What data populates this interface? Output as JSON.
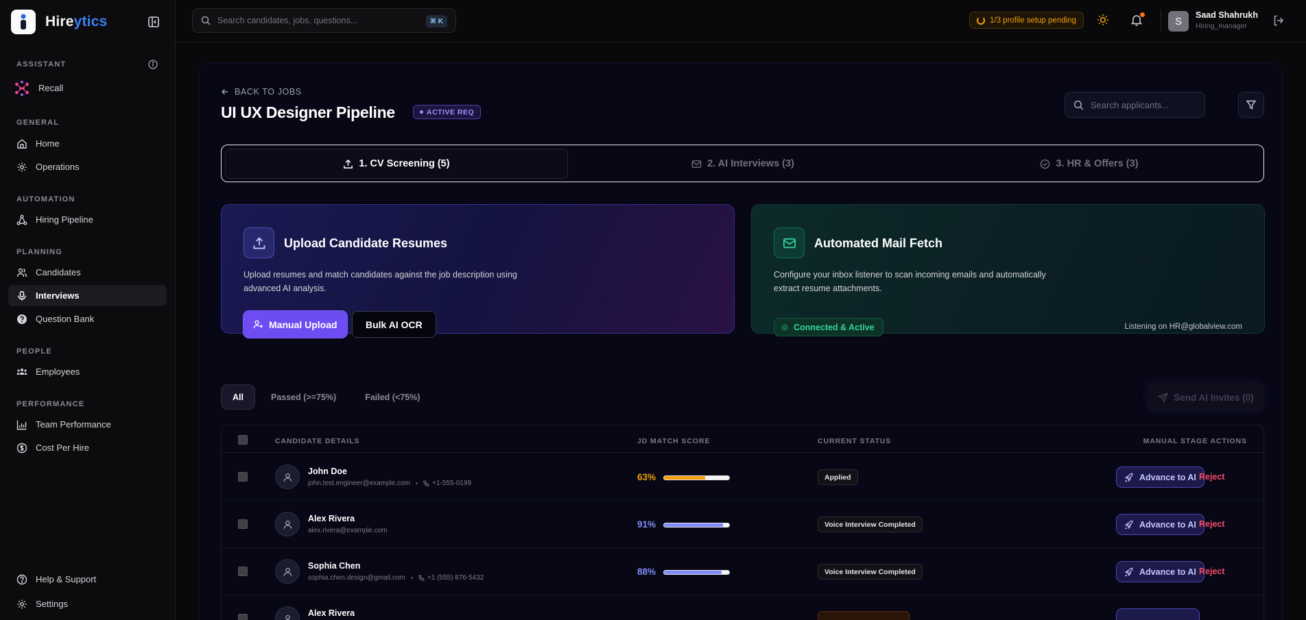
{
  "brand": {
    "name_main": "Hire",
    "name_accent": "ytics"
  },
  "sidebar": {
    "sections": [
      {
        "label": "ASSISTANT"
      },
      {
        "label": "GENERAL"
      },
      {
        "label": "AUTOMATION"
      },
      {
        "label": "PLANNING"
      },
      {
        "label": "PEOPLE"
      },
      {
        "label": "PERFORMANCE"
      }
    ],
    "items": [
      {
        "label": "Recall",
        "icon": "recall-icon"
      },
      {
        "label": "Home",
        "icon": "home-icon"
      },
      {
        "label": "Operations",
        "icon": "gear-icon"
      },
      {
        "label": "Hiring Pipeline",
        "icon": "pipeline-icon"
      },
      {
        "label": "Candidates",
        "icon": "users-icon"
      },
      {
        "label": "Interviews",
        "icon": "mic-icon",
        "active": true
      },
      {
        "label": "Question Bank",
        "icon": "question-icon"
      },
      {
        "label": "Employees",
        "icon": "team-icon"
      },
      {
        "label": "Team Performance",
        "icon": "chart-icon"
      },
      {
        "label": "Cost Per Hire",
        "icon": "dollar-icon"
      }
    ],
    "footer": [
      {
        "label": "Help & Support",
        "icon": "help-icon"
      },
      {
        "label": "Settings",
        "icon": "settings-icon"
      }
    ]
  },
  "topbar": {
    "search_placeholder": "Search candidates, jobs, questions...",
    "shortcut": "⌘ K",
    "pending": "1/3 profile setup pending",
    "user": {
      "initial": "S",
      "name": "Saad Shahrukh",
      "role": "Hiring_manager"
    }
  },
  "page": {
    "back_label": "BACK TO JOBS",
    "title": "UI UX Designer Pipeline",
    "badge": "ACTIVE REQ",
    "search_placeholder": "Search applicants..."
  },
  "tabs": [
    {
      "label": "1. CV Screening (5)",
      "icon": "upload-icon",
      "active": true
    },
    {
      "label": "2. AI Interviews (3)",
      "icon": "mail-icon"
    },
    {
      "label": "3. HR & Offers (3)",
      "icon": "check-circle-icon"
    }
  ],
  "upload_card": {
    "title": "Upload Candidate Resumes",
    "desc": "Upload resumes and match candidates against the job description using advanced AI analysis.",
    "primary": "Manual Upload",
    "secondary": "Bulk AI OCR"
  },
  "mail_card": {
    "title": "Automated Mail Fetch",
    "desc": "Configure your inbox listener to scan incoming emails and automatically extract resume attachments.",
    "status": "Connected & Active",
    "listening": "Listening on HR@globalview.com"
  },
  "filters": [
    {
      "label": "All",
      "active": true
    },
    {
      "label": "Passed (>=75%)"
    },
    {
      "label": "Failed (<75%)"
    }
  ],
  "send_invites": "Send AI Invites (0)",
  "table": {
    "headers": [
      "CANDIDATE DETAILS",
      "JD MATCH SCORE",
      "CURRENT STATUS",
      "MANUAL STAGE ACTIONS"
    ],
    "advance_label": "Advance to AI",
    "reject_label": "Reject",
    "rows": [
      {
        "name": "John Doe",
        "email": "john.test.engineer@example.com",
        "phone": "+1-555-0199",
        "score": "63%",
        "score_value": 63,
        "score_color": "#f59e0b",
        "status": "Applied"
      },
      {
        "name": "Alex Rivera",
        "email": "alex.rivera@example.com",
        "phone": "",
        "score": "91%",
        "score_value": 91,
        "score_color": "#818cf8",
        "status": "Voice Interview Completed"
      },
      {
        "name": "Sophia Chen",
        "email": "sophia.chen.design@gmail.com",
        "phone": "+1 (555) 876-5432",
        "score": "88%",
        "score_value": 88,
        "score_color": "#818cf8",
        "status": "Voice Interview Completed"
      },
      {
        "name": "Alex Rivera",
        "email": "",
        "phone": "",
        "score": "",
        "score_value": 0,
        "score_color": "#818cf8",
        "status": ""
      }
    ]
  }
}
